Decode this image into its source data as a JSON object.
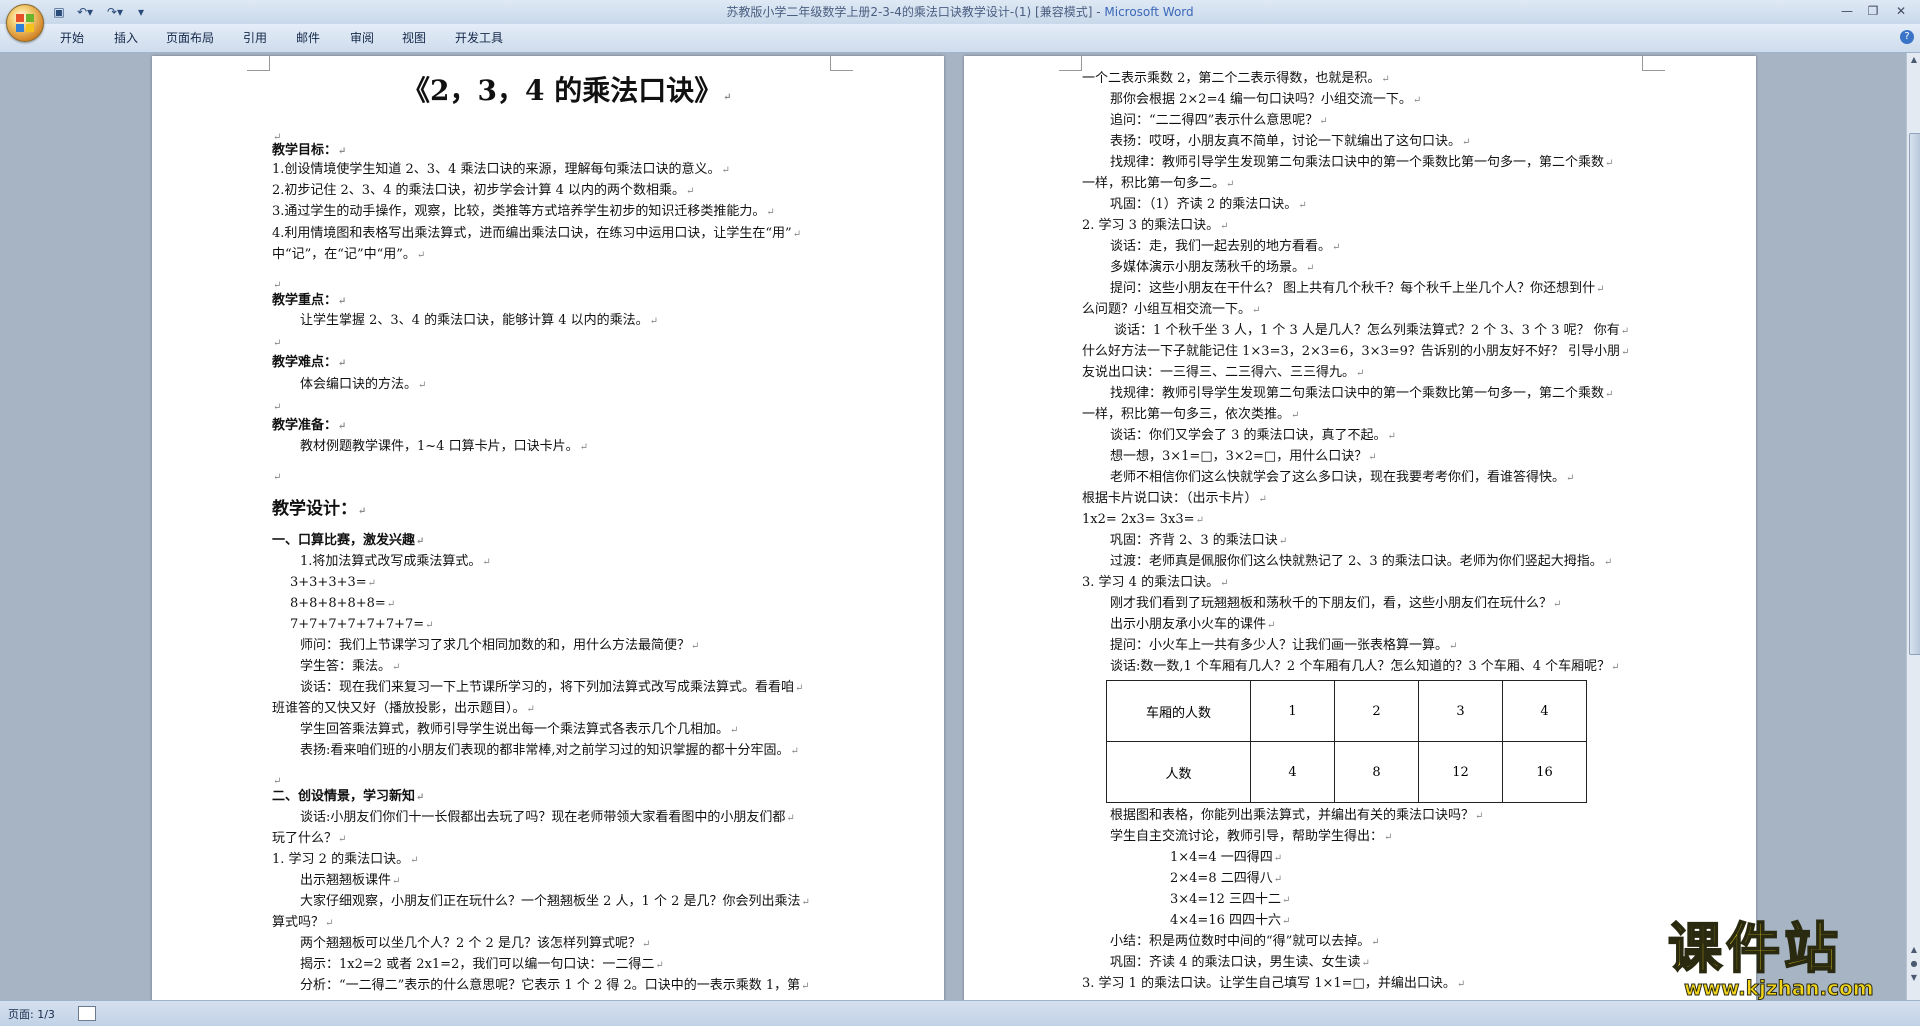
{
  "window": {
    "title_doc": "苏教版小学二年级数学上册2-3-4的乘法口诀教学设计-(1) [兼容模式] - ",
    "title_app": "Microsoft Word"
  },
  "ribbon": {
    "tabs": [
      "开始",
      "插入",
      "页面布局",
      "引用",
      "邮件",
      "审阅",
      "视图",
      "开发工具"
    ]
  },
  "status": {
    "page": "页面: 1/3"
  },
  "watermark": {
    "text": "课件站",
    "url": "www.kjzhan.com"
  },
  "page1": [
    "《2，3，4 的乘法口诀》",
    "",
    "教学目标：",
    "1.创设情境使学生知道 2、3、4 乘法口诀的来源，理解每句乘法口诀的意义。",
    "2.初步记住 2、3、4 的乘法口诀，初步学会计算 4 以内的两个数相乘。",
    "3.通过学生的动手操作，观察，比较，类推等方式培养学生初步的知识迁移类推能力。",
    "4.利用情境图和表格写出乘法算式，进而编出乘法口诀，在练习中运用口诀，让学生在“用”",
    "中“记”，在“记”中“用”。",
    "",
    "教学重点：",
    "让学生掌握 2、3、4 的乘法口诀，能够计算 4 以内的乘法。",
    "",
    "教学难点：",
    "体会编口诀的方法。",
    "",
    "教学准备：",
    "教材例题教学课件，1~4 口算卡片，口诀卡片。",
    "",
    "教学设计：",
    "一、口算比赛，激发兴趣",
    "1.将加法算式改写成乘法算式。",
    "3+3+3+3=",
    "8+8+8+8+8=",
    "7+7+7+7+7+7+7=",
    "师问：我们上节课学习了求几个相同加数的和，用什么方法最简便？",
    "学生答：乘法。",
    "谈话：现在我们来复习一下上节课所学习的，将下列加法算式改写成乘法算式。看看咱",
    "班谁答的又快又好（播放投影，出示题目）。",
    "学生回答乘法算式，教师引导学生说出每一个乘法算式各表示几个几相加。",
    "表扬:看来咱们班的小朋友们表现的都非常棒,对之前学习过的知识掌握的都十分牢固。",
    "",
    "二、创设情景，学习新知",
    "谈话:小朋友们你们十一长假都出去玩了吗？现在老师带领大家看看图中的小朋友们都",
    "玩了什么？",
    "1.   学习 2 的乘法口诀。",
    "出示翘翘板课件",
    "大家仔细观察，小朋友们正在玩什么？一个翘翘板坐 2 人，1 个 2 是几？你会列出乘法",
    "算式吗？",
    "两个翘翘板可以坐几个人？2 个 2 是几？该怎样列算式呢？",
    "揭示：1x2=2 或者 2x1=2，我们可以编一句口诀：一二得二",
    "分析：“一二得二”表示的什么意思呢？它表示 1 个 2 得 2。口诀中的一表示乘数 1，第"
  ],
  "page2": [
    "一个二表示乘数 2，第二个二表示得数，也就是积。",
    "那你会根据 2×2=4 编一句口诀吗？小组交流一下。",
    "追问：“二二得四”表示什么意思呢？",
    "表扬：哎呀，小朋友真不简单，讨论一下就编出了这句口诀。",
    "找规律：教师引导学生发现第二句乘法口诀中的第一个乘数比第一句多一，第二个乘数",
    "一样，积比第一句多二。",
    "巩固：（1）齐读 2 的乘法口诀。",
    "2.   学习 3 的乘法口诀。",
    "谈话：走，我们一起去别的地方看看。",
    "多媒体演示小朋友荡秋千的场景。",
    "提问：这些小朋友在干什么？ 图上共有几个秋千？每个秋千上坐几个人？你还想到什",
    "么问题？小组互相交流一下。",
    "谈话：1 个秋千坐 3 人，1 个 3 人是几人？怎么列乘法算式？2 个 3、3 个 3 呢？ 你有",
    "什么好方法一下子就能记住 1×3=3，2×3=6，3×3=9？告诉别的小朋友好不好？ 引导小朋",
    "友说出口诀：一三得三、二三得六、三三得九。",
    "找规律：教师引导学生发现第二句乘法口诀中的第一个乘数比第一句多一，第二个乘数",
    "一样，积比第一句多三，依次类推。",
    "谈话：你们又学会了 3 的乘法口诀，真了不起。",
    "想一想，3×1=□，3×2=□，用什么口诀？",
    "老师不相信你们这么快就学会了这么多口诀，现在我要考考你们，看谁答得快。",
    "根据卡片说口诀：（出示卡片）",
    "1x2=            2x3=        3x3=",
    "巩固：齐背 2、3 的乘法口诀",
    "过渡：老师真是佩服你们这么快就熟记了 2、3 的乘法口诀。老师为你们竖起大拇指。",
    "3. 学习 4 的乘法口诀。",
    "刚才我们看到了玩翘翘板和荡秋千的下朋友们，看，这些小朋友们在玩什么？",
    "出示小朋友承小火车的课件",
    "提问：小火车上一共有多少人？让我们画一张表格算一算。",
    "谈话:数一数,1 个车厢有几人？2 个车厢有几人？怎么知道的？3 个车厢、4 个车厢呢？",
    "根据图和表格，你能列出乘法算式，并编出有关的乘法口诀吗？",
    "学生自主交流讨论，教师引导，帮助学生得出：",
    "1×4=4          一四得四",
    "2×4=8          二四得八",
    "3×4=12         三四十二",
    "4×4=16          四四十六",
    "小结：积是两位数时中间的“得”就可以去掉。",
    "巩固：齐读 4 的乘法口诀，男生读、女生读",
    "3.   学习 1 的乘法口诀。让学生自己填写 1×1=□，并编出口诀。"
  ],
  "table": {
    "headers": [
      "车厢的人数",
      "1",
      "2",
      "3",
      "4"
    ],
    "row": [
      "人数",
      "4",
      "8",
      "12",
      "16"
    ]
  }
}
